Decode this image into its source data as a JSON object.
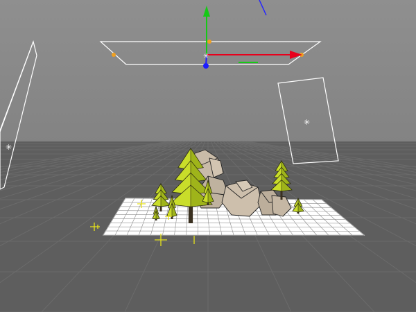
{
  "viewport": {
    "type": "3d-perspective-viewport",
    "sky_color": "#8a8a8a",
    "floor_color": "#5e5e5e",
    "grid_color": "#6d6d6d",
    "selection_color": "#ffffff"
  },
  "gizmo": {
    "x_axis_color": "#e8001c",
    "y_axis_color": "#16c916",
    "z_axis_color": "#1c1cff",
    "handle_color": "#f0a020"
  },
  "scene": {
    "ground_plane_color": "#ffffff",
    "tree_color": "#c9dd2a",
    "rock_color": "#c7b9a6",
    "helper_marker_color": "#e6e21a",
    "icons": [
      "light-handle-icon",
      "light-handle-icon"
    ]
  }
}
